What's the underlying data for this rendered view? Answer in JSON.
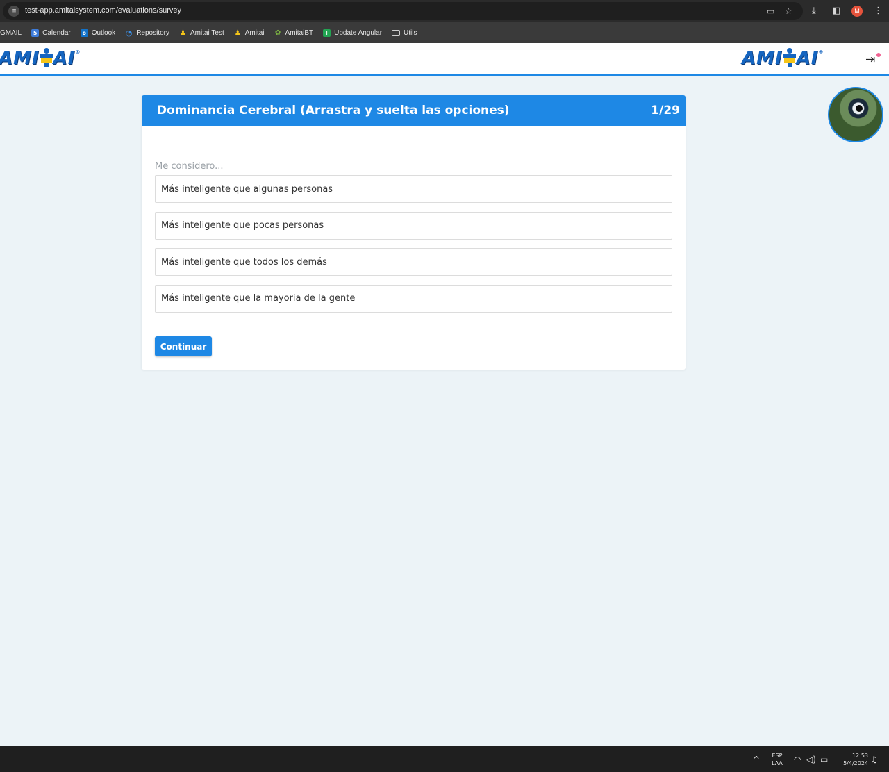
{
  "browser": {
    "url": "test-app.amitaisystem.com/evaluations/survey",
    "profile_initial": "M",
    "bookmarks": [
      {
        "label": "GMAIL",
        "icon": "none"
      },
      {
        "label": "Calendar",
        "icon": "calendar-icon"
      },
      {
        "label": "Outlook",
        "icon": "outlook-icon"
      },
      {
        "label": "Repository",
        "icon": "repository-icon"
      },
      {
        "label": "Amitai Test",
        "icon": "amitai-icon"
      },
      {
        "label": "Amitai",
        "icon": "amitai-icon"
      },
      {
        "label": "AmitaiBT",
        "icon": "amitai-bt-icon"
      },
      {
        "label": "Update Angular",
        "icon": "plus-sheet-icon"
      },
      {
        "label": "Utils",
        "icon": "folder-icon"
      }
    ]
  },
  "header": {
    "logo_text_left": "AMI",
    "logo_text_right": "AI",
    "logo_reg": "®"
  },
  "survey": {
    "title": "Dominancia Cerebral (Arrastra y suelta las opciones)",
    "progress": "1/29",
    "question": "Me considero...",
    "options": [
      "Más inteligente que algunas personas",
      "Más inteligente que pocas personas",
      "Más inteligente que todos los demás",
      "Más inteligente que la mayoria de la gente"
    ],
    "continue_label": "Continuar"
  },
  "taskbar": {
    "lang_top": "ESP",
    "lang_bottom": "LAA",
    "time": "12:53",
    "date": "5/4/2024"
  },
  "colors": {
    "accent": "#1e88e5",
    "background": "#ecf3f7",
    "logo_blue": "#1565c0",
    "logo_gold": "#f5c518"
  }
}
